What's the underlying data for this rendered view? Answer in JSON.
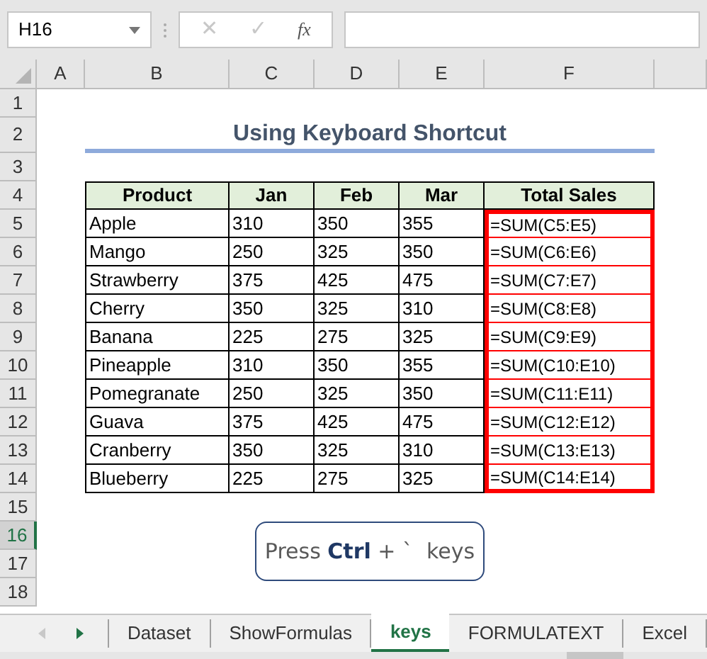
{
  "name_box": "H16",
  "formula_bar": {
    "cancel": "✕",
    "enter": "✓",
    "fx": "fx"
  },
  "columns": [
    "A",
    "B",
    "C",
    "D",
    "E",
    "F"
  ],
  "rows": [
    {
      "label": "1",
      "selected": false
    },
    {
      "label": "2",
      "selected": false
    },
    {
      "label": "3",
      "selected": false
    },
    {
      "label": "4",
      "selected": false
    },
    {
      "label": "5",
      "selected": false
    },
    {
      "label": "6",
      "selected": false
    },
    {
      "label": "7",
      "selected": false
    },
    {
      "label": "8",
      "selected": false
    },
    {
      "label": "9",
      "selected": false
    },
    {
      "label": "10",
      "selected": false
    },
    {
      "label": "11",
      "selected": false
    },
    {
      "label": "12",
      "selected": false
    },
    {
      "label": "13",
      "selected": false
    },
    {
      "label": "14",
      "selected": false
    },
    {
      "label": "15",
      "selected": false
    },
    {
      "label": "16",
      "selected": true
    },
    {
      "label": "17",
      "selected": false
    },
    {
      "label": "18",
      "selected": false
    }
  ],
  "title": "Using Keyboard Shortcut",
  "table": {
    "columns": [
      "Product",
      "Jan",
      "Feb",
      "Mar",
      "Total Sales"
    ],
    "formulas_highlighted": true,
    "rows": [
      [
        "Apple",
        "310",
        "350",
        "355",
        "=SUM(C5:E5)"
      ],
      [
        "Mango",
        "250",
        "325",
        "350",
        "=SUM(C6:E6)"
      ],
      [
        "Strawberry",
        "375",
        "425",
        "475",
        "=SUM(C7:E7)"
      ],
      [
        "Cherry",
        "350",
        "325",
        "310",
        "=SUM(C8:E8)"
      ],
      [
        "Banana",
        "225",
        "275",
        "325",
        "=SUM(C9:E9)"
      ],
      [
        "Pineapple",
        "310",
        "350",
        "355",
        "=SUM(C10:E10)"
      ],
      [
        "Pomegranate",
        "250",
        "325",
        "350",
        "=SUM(C11:E11)"
      ],
      [
        "Guava",
        "375",
        "425",
        "475",
        "=SUM(C12:E12)"
      ],
      [
        "Cranberry",
        "350",
        "325",
        "310",
        "=SUM(C13:E13)"
      ],
      [
        "Blueberry",
        "225",
        "275",
        "325",
        "=SUM(C14:E14)"
      ]
    ]
  },
  "note": "Press **Ctrl** + `  keys",
  "sheet_tabs": [
    {
      "label": "Dataset",
      "selected": false
    },
    {
      "label": "ShowFormulas",
      "selected": false
    },
    {
      "label": "keys",
      "selected": true
    },
    {
      "label": "FORMULATEXT",
      "selected": false
    },
    {
      "label": "Excel",
      "selected": false
    }
  ]
}
